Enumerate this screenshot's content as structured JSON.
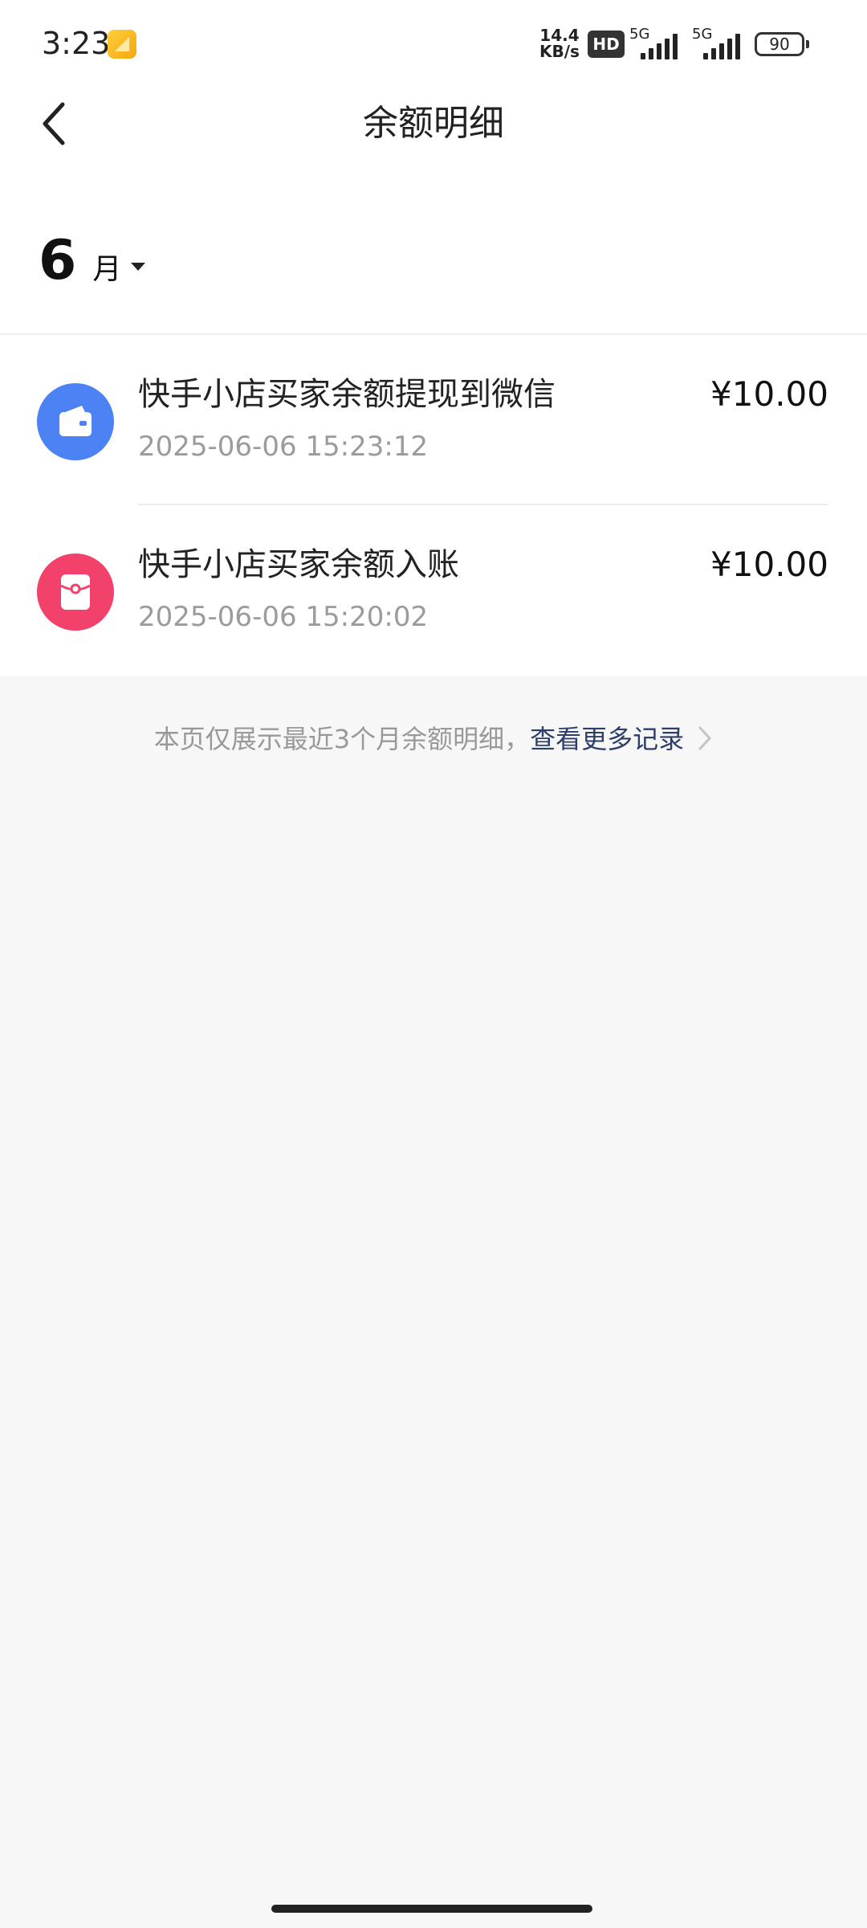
{
  "status_bar": {
    "time": "3:23",
    "network_speed_value": "14.4",
    "network_speed_unit": "KB/s",
    "hd_label": "HD",
    "sim1_label": "5G",
    "sim2_label": "5G",
    "battery": "90"
  },
  "nav": {
    "title": "余额明细"
  },
  "month_selector": {
    "month": "6",
    "unit": "月"
  },
  "transactions": [
    {
      "title": "快手小店买家余额提现到微信",
      "time": "2025-06-06 15:23:12",
      "amount": "¥10.00",
      "icon": "wallet-icon",
      "icon_color": "#4d82f5"
    },
    {
      "title": "快手小店买家余额入账",
      "time": "2025-06-06 15:20:02",
      "amount": "¥10.00",
      "icon": "red-packet-icon",
      "icon_color": "#f2426b"
    }
  ],
  "footer": {
    "note": "本页仅展示最近3个月余额明细，",
    "link": "查看更多记录"
  }
}
